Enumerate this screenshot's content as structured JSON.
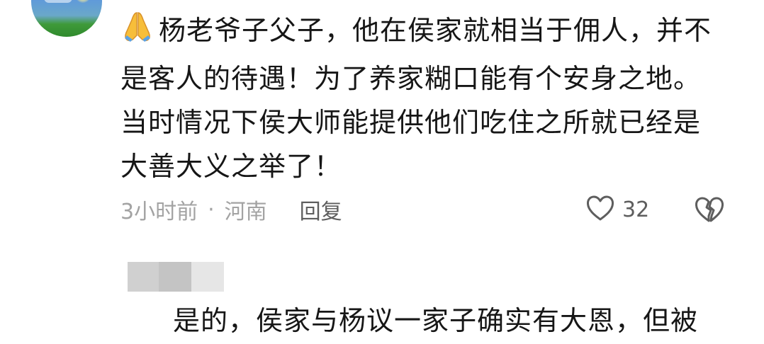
{
  "comment": {
    "emoji": "folded-hands",
    "line1": "杨老爷子父子，他在侯家就相当于佣人，并不",
    "line2": "是客人的待遇！为了养家糊口能有个安身之地。",
    "line3": "当时情况下侯大师能提供他们吃住之所就已经是",
    "line4": "大善大义之举了！",
    "time": "3小时前",
    "separator": "·",
    "location": "河南",
    "reply_label": "回复",
    "like_count": "32"
  },
  "reply_comment": {
    "text": "是的，侯家与杨议一家子确实有大恩，但被"
  },
  "colors": {
    "text": "#161616",
    "meta": "#a3a3a3",
    "action": "#5e5e5e",
    "emoji": "#f5b731"
  }
}
